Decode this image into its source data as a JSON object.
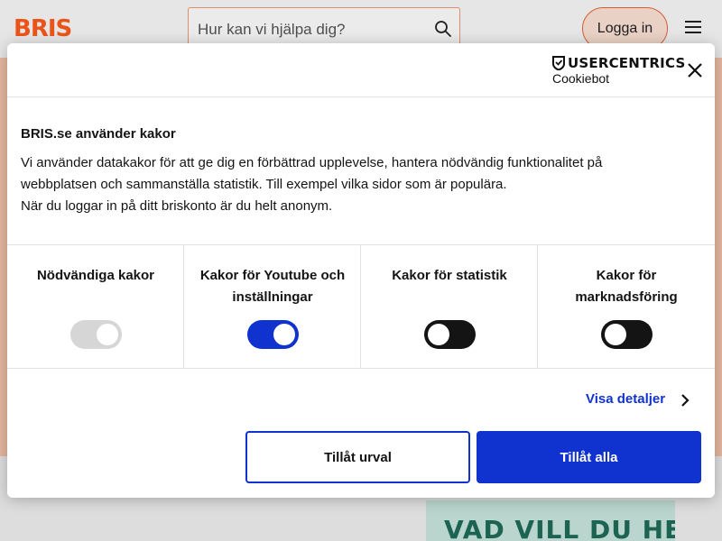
{
  "site": {
    "logo": "BRIS",
    "search_placeholder": "Hur kan vi hjälpa dig?",
    "login_label": "Logga in",
    "teaser_text": "VAD VILL DU HELST"
  },
  "dialog": {
    "brand_title": "USERCENTRICS",
    "brand_subtitle": "Cookiebot",
    "title": "BRIS.se använder kakor",
    "text_line1": "Vi använder datakakor för att ge dig en förbättrad upplevelse, hantera nödvändig funktionalitet på",
    "text_line2": "webbplatsen och sammanställa statistik. Till exempel vilka sidor som är populära.",
    "text_line3": "När du loggar in på ditt briskonto är du helt anonym.",
    "toggles": [
      {
        "label": "Nödvändiga kakor",
        "state": "on-disabled"
      },
      {
        "label": "Kakor för Youtube och inställningar",
        "state": "on"
      },
      {
        "label": "Kakor för statistik",
        "state": "off"
      },
      {
        "label": "Kakor för marknadsföring",
        "state": "off"
      }
    ],
    "details_link": "Visa detaljer",
    "allow_selection": "Tillåt urval",
    "allow_all": "Tillåt alla"
  },
  "colors": {
    "brand_orange": "#ff5c1b",
    "primary_blue": "#1032cf",
    "hero_bg": "#f9c8ad"
  }
}
